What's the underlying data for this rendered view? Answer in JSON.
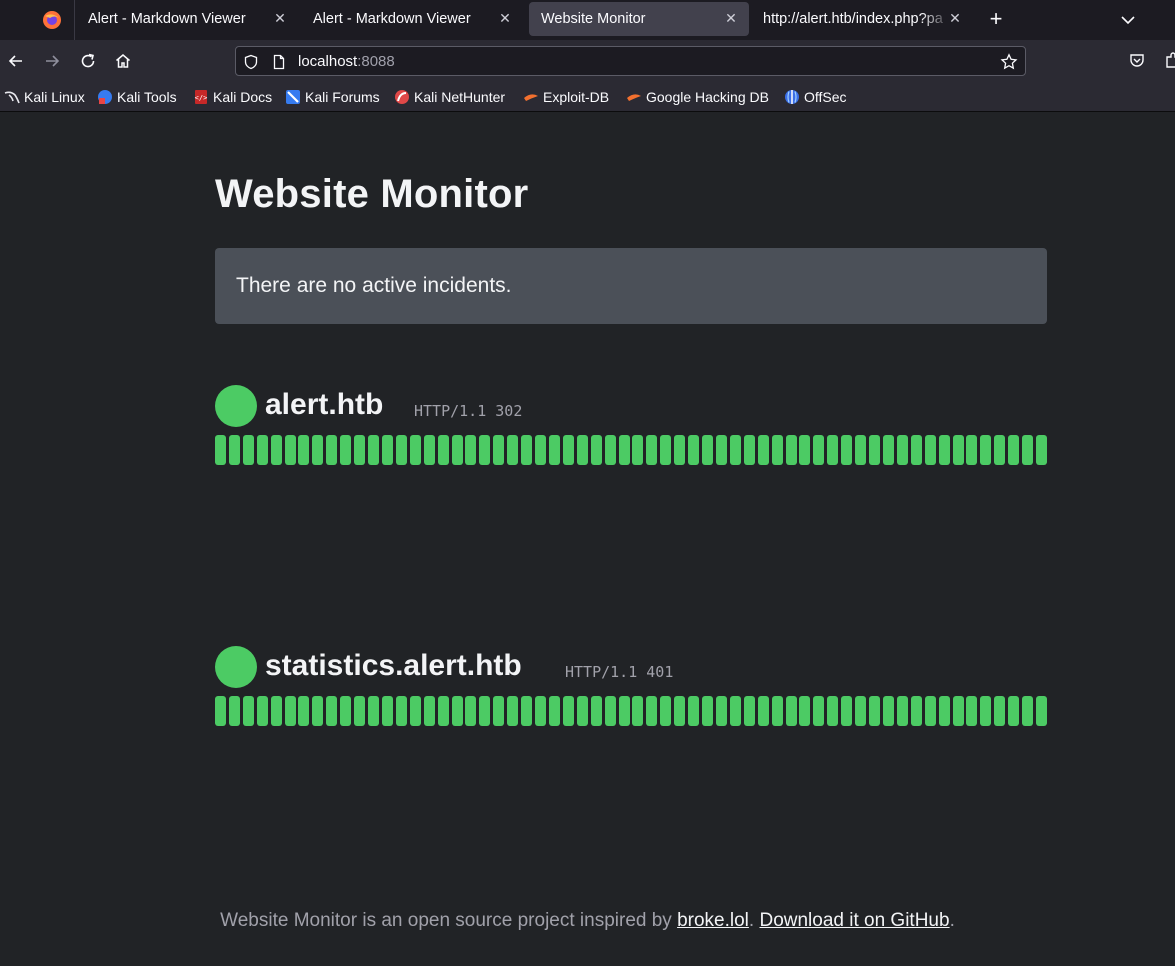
{
  "browser": {
    "tabs": [
      {
        "label": "Alert - Markdown Viewer",
        "active": false
      },
      {
        "label": "Alert - Markdown Viewer",
        "active": false
      },
      {
        "label": "Website Monitor",
        "active": true
      },
      {
        "label": "http://alert.htb/index.php?pa",
        "active": false
      }
    ],
    "url_host": "localhost",
    "url_port": ":8088",
    "bookmarks": [
      {
        "label": "Kali Linux",
        "icon": "kali-dragon-icon"
      },
      {
        "label": "Kali Tools",
        "icon": "kali-tools-icon"
      },
      {
        "label": "Kali Docs",
        "icon": "kali-docs-icon"
      },
      {
        "label": "Kali Forums",
        "icon": "kali-forums-icon"
      },
      {
        "label": "Kali NetHunter",
        "icon": "kali-nethunter-icon"
      },
      {
        "label": "Exploit-DB",
        "icon": "exploit-db-icon"
      },
      {
        "label": "Google Hacking DB",
        "icon": "google-hacking-db-icon"
      },
      {
        "label": "OffSec",
        "icon": "offsec-icon"
      }
    ]
  },
  "page": {
    "title": "Website Monitor",
    "incident_message": "There are no active incidents.",
    "sites": [
      {
        "name": "alert.htb",
        "status": "HTTP/1.1 302",
        "up_bars": 60
      },
      {
        "name": "statistics.alert.htb",
        "status": "HTTP/1.1 401",
        "up_bars": 60
      }
    ],
    "footer": {
      "prefix": "Website Monitor is an open source project inspired by ",
      "link1": "broke.lol",
      "middle": ". ",
      "link2": "Download it on GitHub",
      "suffix": "."
    }
  },
  "colors": {
    "status_up": "#4ccb64",
    "background": "#212326",
    "incident_box": "#4b5058"
  }
}
